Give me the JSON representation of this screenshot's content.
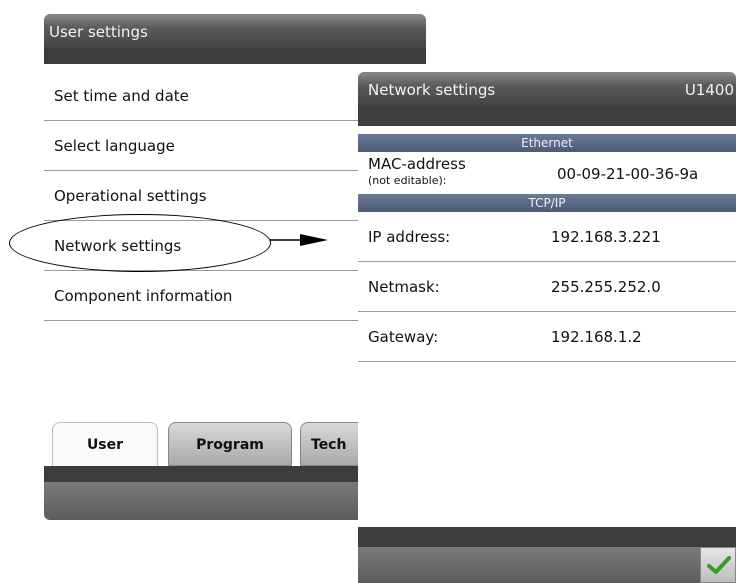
{
  "left_panel": {
    "title": "User settings",
    "menu_items": [
      {
        "label": "Set time and date"
      },
      {
        "label": "Select language"
      },
      {
        "label": "Operational settings"
      },
      {
        "label": "Network settings"
      },
      {
        "label": "Component information"
      }
    ],
    "tabs": [
      {
        "label": "User",
        "selected": true
      },
      {
        "label": "Program",
        "selected": false
      },
      {
        "label": "Tech",
        "selected": false
      }
    ]
  },
  "right_panel": {
    "title": "Network settings",
    "device_code": "U1400",
    "ethernet_section": "Ethernet",
    "mac": {
      "label": "MAC-address",
      "note": "(not editable):",
      "value": "00-09-21-00-36-9a"
    },
    "tcpip_section": "TCP/IP",
    "fields": [
      {
        "label": "IP address:",
        "value": "192.168.3.221"
      },
      {
        "label": "Netmask:",
        "value": "255.255.252.0"
      },
      {
        "label": "Gateway:",
        "value": "192.168.1.2"
      }
    ],
    "ok_icon": "checkmark-icon"
  },
  "colors": {
    "section_bar": "#5a6886",
    "check_green": "#3a9a2a"
  }
}
